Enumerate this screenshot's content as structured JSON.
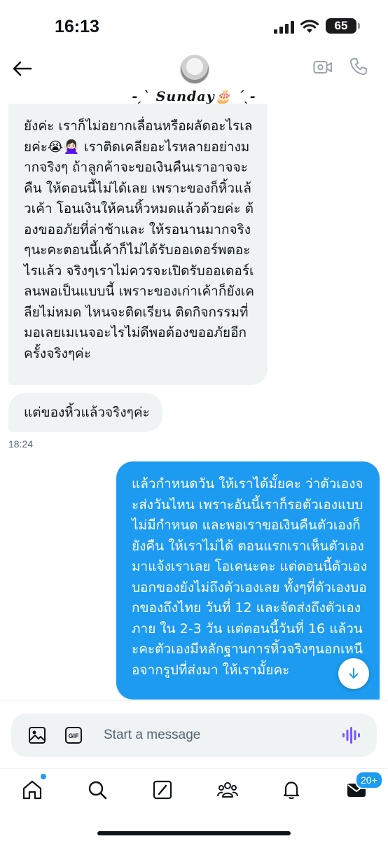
{
  "status_bar": {
    "time": "16:13",
    "battery": "65"
  },
  "header": {
    "conversation_name": "-ˏˋ Sunday🎂 ˊˎ-"
  },
  "messages": [
    {
      "direction": "received",
      "text": "ยังค่ะ เราก็ไม่อยากเลื่อนหรือผลัดอะไรเลยค่ะ😭🙅🏻‍♀️ เราติดเคลียอะไรหลายอย่างมากจริงๆ ถ้าลูกค้าจะขอเงินคืนเราอาจจะคืน ให้ตอนนี้ไม่ได้เลย เพราะของก็หิ้วแล้วเค้า โอนเงินให้คนหิ้วหมดแล้วด้วยค่ะ ต้องขออภัยที่ล่าช้าและ ให้รอนานมากจริงๆนะคะตอนนี้เค้าก็ไม่ได้รับออเดอร์พตอะไรแล้ว จริงๆเราไม่ควรจะเปิดรับออเดอร์เลนพอเป็นแบบนี้ เพราะของเก่าเค้าก็ยังเคลียไม่หมด ไหนจะติดเรียน ติดกิจกรรมที่มอเลยเมเนจอะไรไม่ดีพอต้องขออภัยอีกครั้งจริงๆค่ะ"
    },
    {
      "direction": "received",
      "text": "แต่ของหิ้วแล้วจริงๆค่ะ"
    },
    {
      "timestamp": "18:24"
    },
    {
      "direction": "sent",
      "text": "แล้วกำหนดวัน ให้เราได้มั้ยคะ ว่าตัวเองจะส่งวันไหน เพราะอันนี้เราก็รอตัวเองแบบไม่มีกำหนด และพอเราขอเงินคืนตัวเองก็ยังคืน ให้เราไม่ได้ ตอนแรกเราเห็นตัวเองมาแจ้งเราเลย โอเคนะคะ แต่ตอนนี้ตัวเองบอกของยังไม่ถึงตัวเองเลย ทั้งๆที่ตัวเองบอกของถึงไทย วันที่ 12 และจัดส่งถึงตัวเองภาย ใน 2-3 วัน แต่ตอนนี้วันที่ 16 แล้วนะคะตัวเองมีหลักฐานการหิ้วจริงๆนอกเหนือจากรูปที่ส่งมา ให้เรามั้ยคะ"
    }
  ],
  "composer": {
    "placeholder": "Start a message"
  },
  "bottom_nav": {
    "items": [
      "home-icon",
      "search-icon",
      "grok-icon",
      "communities-icon",
      "notifications-icon",
      "messages-icon"
    ],
    "messages_badge": "20+"
  },
  "colors": {
    "accent": "#1d9bf0",
    "received_bubble": "#eff3f4",
    "text": "#0f1419",
    "muted": "#536471"
  }
}
